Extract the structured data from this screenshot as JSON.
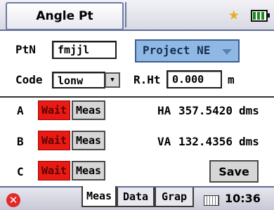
{
  "window": {
    "title": "Angle Pt"
  },
  "status": {
    "star_icon": "star-icon",
    "battery_icon": "battery-icon",
    "accent_color": "#e5b01a"
  },
  "form": {
    "ptn_label": "PtN",
    "ptn_value": "fmjjl",
    "project_value": "Project NE",
    "code_label": "Code",
    "code_value": "lonw",
    "rht_label": "R.Ht",
    "rht_value": "0.000",
    "rht_unit": "m"
  },
  "points": [
    {
      "label": "A",
      "wait_label": "Wait",
      "meas_label": "Meas"
    },
    {
      "label": "B",
      "wait_label": "Wait",
      "meas_label": "Meas"
    },
    {
      "label": "C",
      "wait_label": "Wait",
      "meas_label": "Meas"
    }
  ],
  "readouts": {
    "ha_label": "HA",
    "ha_value": "357.5420",
    "ha_unit": "dms",
    "va_label": "VA",
    "va_value": "132.4356",
    "va_unit": "dms"
  },
  "save_label": "Save",
  "tabs": [
    {
      "label": "Meas",
      "active": true
    },
    {
      "label": "Data",
      "active": false
    },
    {
      "label": "Grap",
      "active": false
    }
  ],
  "taskbar": {
    "time": "10:36",
    "close_icon": "close-icon",
    "keyboard_icon": "keyboard-icon"
  },
  "colors": {
    "wait": "#e81b14",
    "project_select": "#8fb9e4"
  }
}
